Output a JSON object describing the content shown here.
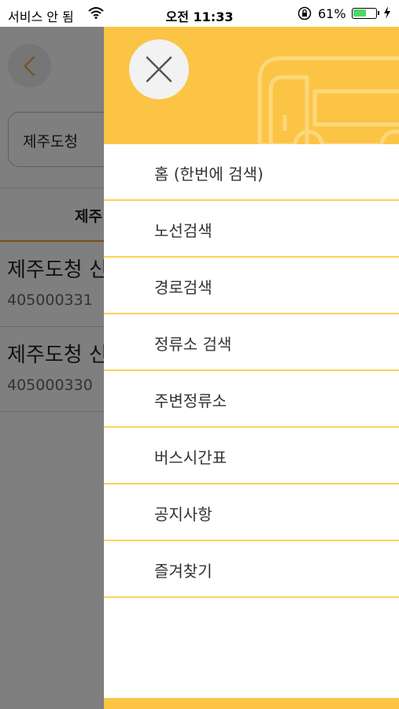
{
  "status_bar": {
    "carrier": "서비스 안 됨",
    "time": "오전 11:33",
    "battery_percent": "61%",
    "battery_level": 0.61,
    "icons": [
      "wifi-icon",
      "orientation-lock-icon",
      "battery-icon",
      "charging-bolt-icon"
    ]
  },
  "background": {
    "search_value": "제주도청",
    "tab_label": "제주",
    "results": [
      {
        "name": "제주도청 신",
        "code": "405000331"
      },
      {
        "name": "제주도청 신",
        "code": "405000330"
      }
    ]
  },
  "drawer": {
    "menu": [
      {
        "label": "홈 (한번에 검색)"
      },
      {
        "label": "노선검색"
      },
      {
        "label": "경로검색"
      },
      {
        "label": "정류소 검색"
      },
      {
        "label": "주변정류소"
      },
      {
        "label": "버스시간표"
      },
      {
        "label": "공지사항"
      },
      {
        "label": "즐겨찾기"
      }
    ]
  },
  "colors": {
    "accent": "#fcc445",
    "divider": "#fcd35d",
    "back_accent": "#e5a52d"
  }
}
